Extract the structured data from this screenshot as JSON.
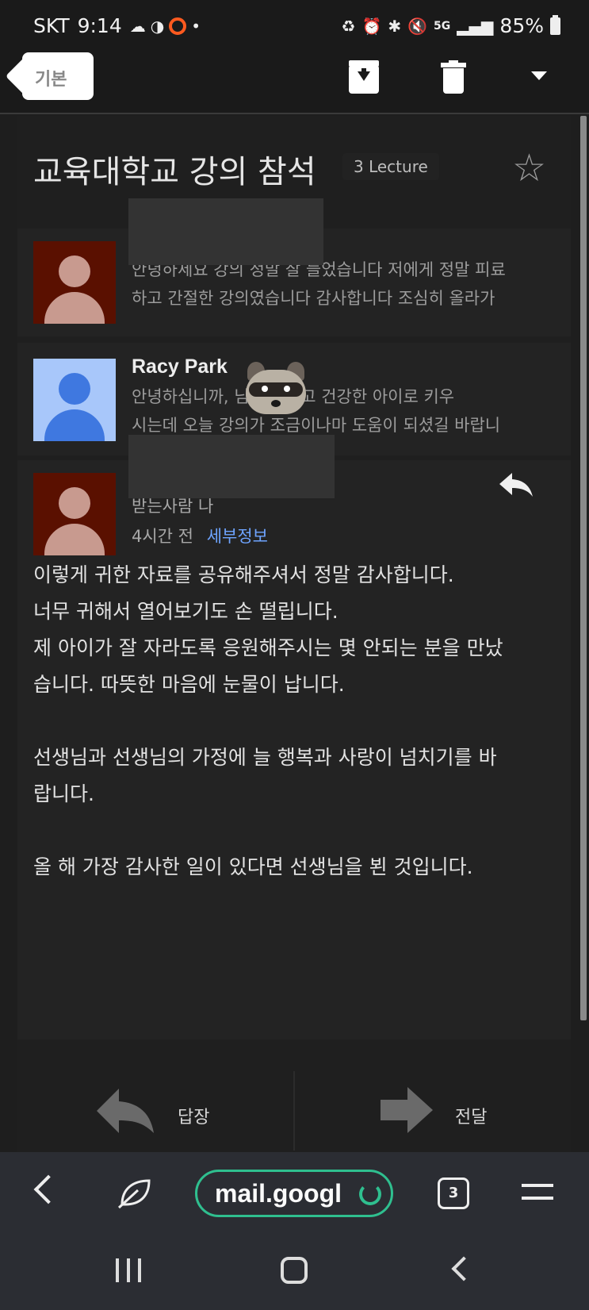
{
  "status_bar": {
    "carrier": "SKT",
    "time": "9:14",
    "battery": "85%",
    "network": "5G"
  },
  "toolbar": {
    "back_label": "기본"
  },
  "thread": {
    "subject": "교육대학교 강의 참석",
    "label": "3 Lecture"
  },
  "messages": [
    {
      "snippet_line1": "안녕하세요 강의 정말 잘 들었습니다 저에게 정말 피료",
      "snippet_line2": "하고 간절한 강의였습니다 감사합니다 조심히 올라가"
    },
    {
      "sender": "Racy Park",
      "snippet_line1": "안녕하십니까,            님 행복하고 건강한 아이로 키우",
      "snippet_line2": "시는데 오늘 강의가 조금이나마 도움이 되셨길 바랍니"
    },
    {
      "recipient": "받는사람 나",
      "time": "4시간 전",
      "details_link": "세부정보",
      "body": [
        "이렇게 귀한 자료를 공유해주셔서 정말 감사합니다.",
        "너무 귀해서 열어보기도 손 떨립니다.",
        "제 아이가 잘 자라도록 응원해주시는 몇 안되는 분을 만났",
        "습니다.  따뜻한 마음에 눈물이 납니다.",
        "",
        "선생님과 선생님의 가정에 늘 행복과 사랑이 넘치기를 바",
        "랍니다.",
        "",
        "올 해 가장 감사한 일이 있다면 선생님을 뵌 것입니다."
      ]
    }
  ],
  "actions": {
    "reply_label": "답장",
    "forward_label": "전달"
  },
  "browser": {
    "url": "mail.googl",
    "tab_count": "3"
  },
  "colors": {
    "accent_link": "#6ea4ff",
    "url_border": "#2fbf8f",
    "avatar_red": "#5a1000",
    "avatar_blue": "#a8c7fa"
  }
}
